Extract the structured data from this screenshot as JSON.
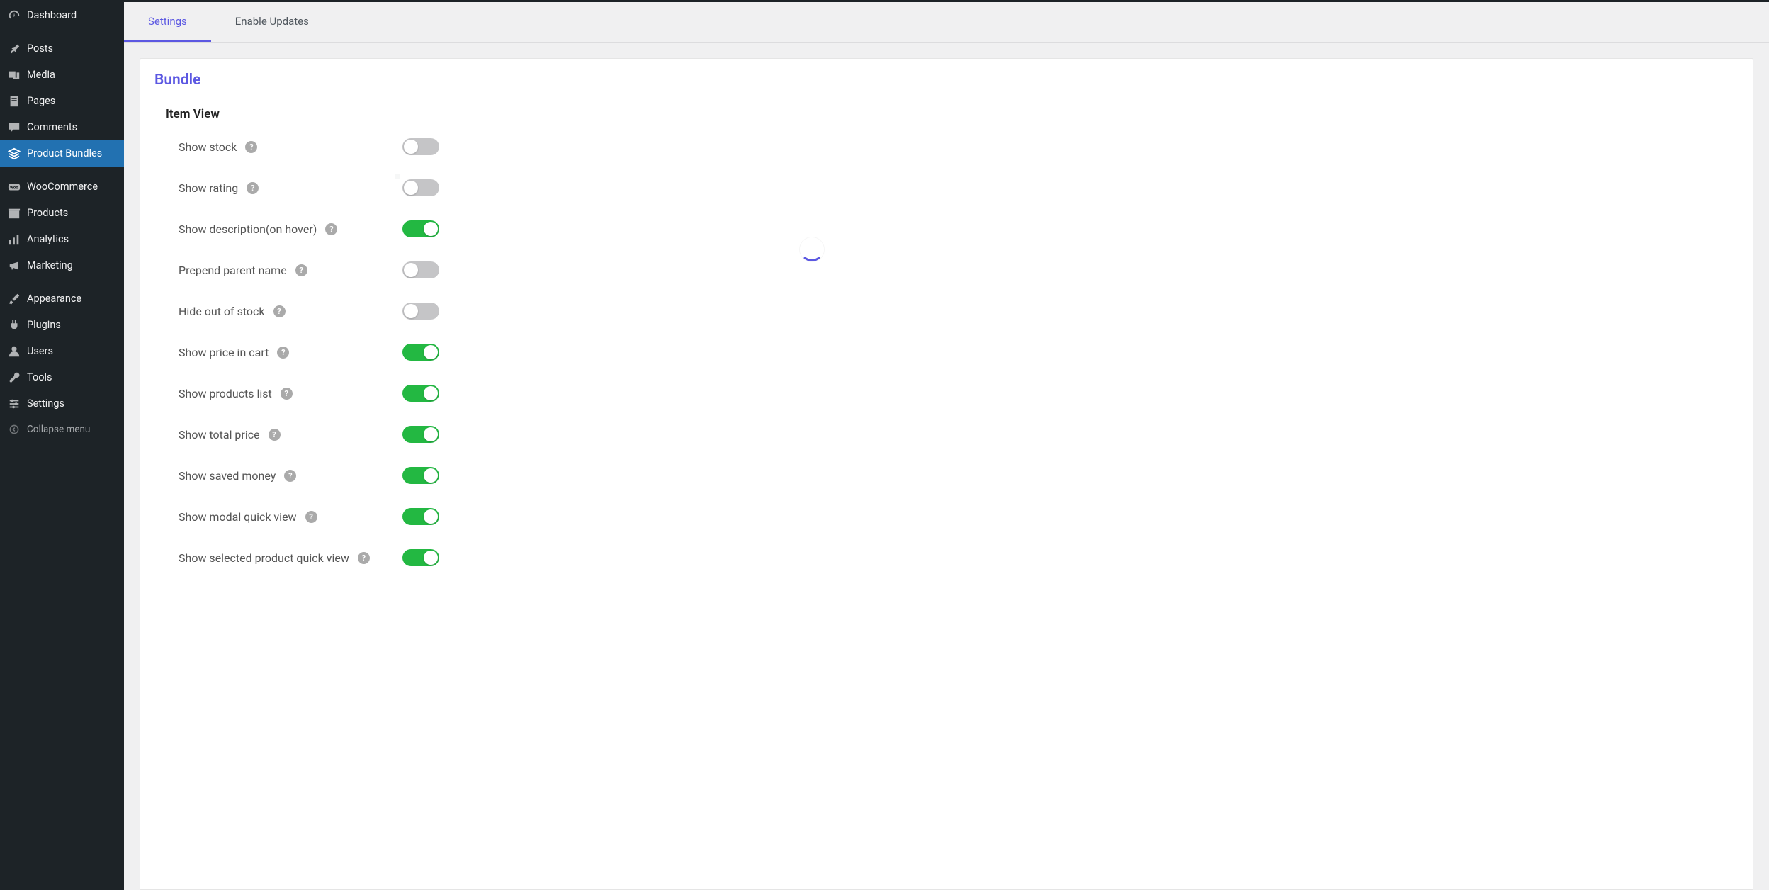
{
  "sidebar": {
    "items": [
      {
        "id": "dashboard",
        "label": "Dashboard",
        "icon": "gauge"
      },
      {
        "id": "posts",
        "label": "Posts",
        "icon": "pin"
      },
      {
        "id": "media",
        "label": "Media",
        "icon": "media"
      },
      {
        "id": "pages",
        "label": "Pages",
        "icon": "page"
      },
      {
        "id": "comments",
        "label": "Comments",
        "icon": "comment"
      },
      {
        "id": "product-bundles",
        "label": "Product Bundles",
        "icon": "layers",
        "active": true
      },
      {
        "id": "woocommerce",
        "label": "WooCommerce",
        "icon": "woo"
      },
      {
        "id": "products",
        "label": "Products",
        "icon": "archive"
      },
      {
        "id": "analytics",
        "label": "Analytics",
        "icon": "bars"
      },
      {
        "id": "marketing",
        "label": "Marketing",
        "icon": "megaphone"
      },
      {
        "id": "appearance",
        "label": "Appearance",
        "icon": "brush"
      },
      {
        "id": "plugins",
        "label": "Plugins",
        "icon": "plug"
      },
      {
        "id": "users",
        "label": "Users",
        "icon": "user"
      },
      {
        "id": "tools",
        "label": "Tools",
        "icon": "wrench"
      },
      {
        "id": "settings",
        "label": "Settings",
        "icon": "sliders"
      }
    ],
    "collapse_label": "Collapse menu"
  },
  "tabs": [
    {
      "id": "settings",
      "label": "Settings",
      "active": true
    },
    {
      "id": "enable-updates",
      "label": "Enable Updates",
      "active": false
    }
  ],
  "section": {
    "title": "Bundle",
    "subtitle": "Item View"
  },
  "settings": [
    {
      "key": "show_stock",
      "label": "Show stock",
      "value": false
    },
    {
      "key": "show_rating",
      "label": "Show rating",
      "value": false
    },
    {
      "key": "show_description_hover",
      "label": "Show description(on hover)",
      "value": true
    },
    {
      "key": "prepend_parent_name",
      "label": "Prepend parent name",
      "value": false
    },
    {
      "key": "hide_out_of_stock",
      "label": "Hide out of stock",
      "value": false
    },
    {
      "key": "show_price_in_cart",
      "label": "Show price in cart",
      "value": true
    },
    {
      "key": "show_products_list",
      "label": "Show products list",
      "value": true
    },
    {
      "key": "show_total_price",
      "label": "Show total price",
      "value": true
    },
    {
      "key": "show_saved_money",
      "label": "Show saved money",
      "value": true
    },
    {
      "key": "show_modal_quick_view",
      "label": "Show modal quick view",
      "value": true
    },
    {
      "key": "show_selected_product_quick_view",
      "label": "Show selected product quick view",
      "value": true
    }
  ]
}
